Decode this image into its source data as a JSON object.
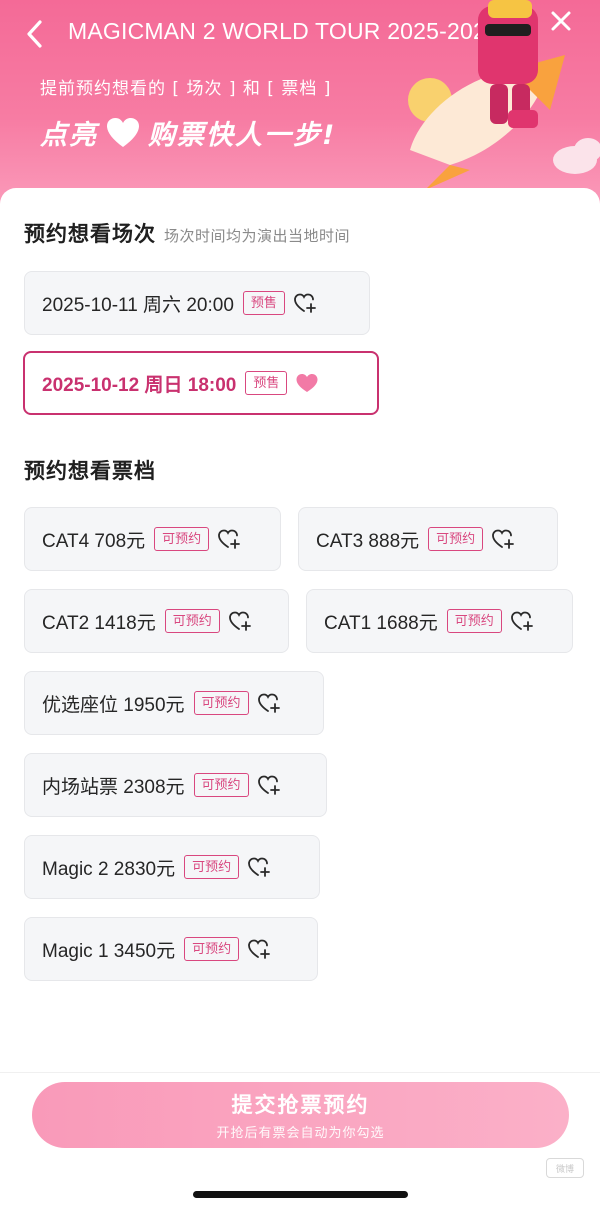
{
  "header": {
    "title": "MAGICMAN 2 WORLD TOUR 2025-2026...",
    "subtitle": "提前预约想看的 [ 场次 ] 和 [ 票档 ]",
    "slogan_left": "点亮",
    "slogan_right": "购票快人一步!"
  },
  "sessions_section": {
    "title": "预约想看场次",
    "note": "场次时间均为演出当地时间",
    "items": [
      {
        "label": "2025-10-11 周六 20:00",
        "tag": "预售",
        "selected": false
      },
      {
        "label": "2025-10-12 周日 18:00",
        "tag": "预售",
        "selected": true
      }
    ]
  },
  "tiers_section": {
    "title": "预约想看票档",
    "items": [
      {
        "label": "CAT4 708元",
        "tag": "可预约"
      },
      {
        "label": "CAT3 888元",
        "tag": "可预约"
      },
      {
        "label": "CAT2 1418元",
        "tag": "可预约"
      },
      {
        "label": "CAT1 1688元",
        "tag": "可预约"
      },
      {
        "label": "优选座位 1950元",
        "tag": "可预约"
      },
      {
        "label": "内场站票 2308元",
        "tag": "可预约"
      },
      {
        "label": "Magic 2 2830元",
        "tag": "可预约"
      },
      {
        "label": "Magic 1 3450元",
        "tag": "可预约"
      }
    ]
  },
  "footer": {
    "submit_label": "提交抢票预约",
    "submit_sub": "开抢后有票会自动为你勾选",
    "watermark": "微博"
  },
  "colors": {
    "header_pink": "#f46a97",
    "accent_magenta": "#c9316f",
    "tag_pink": "#d9477f",
    "button_pink": "#f99ab9"
  }
}
